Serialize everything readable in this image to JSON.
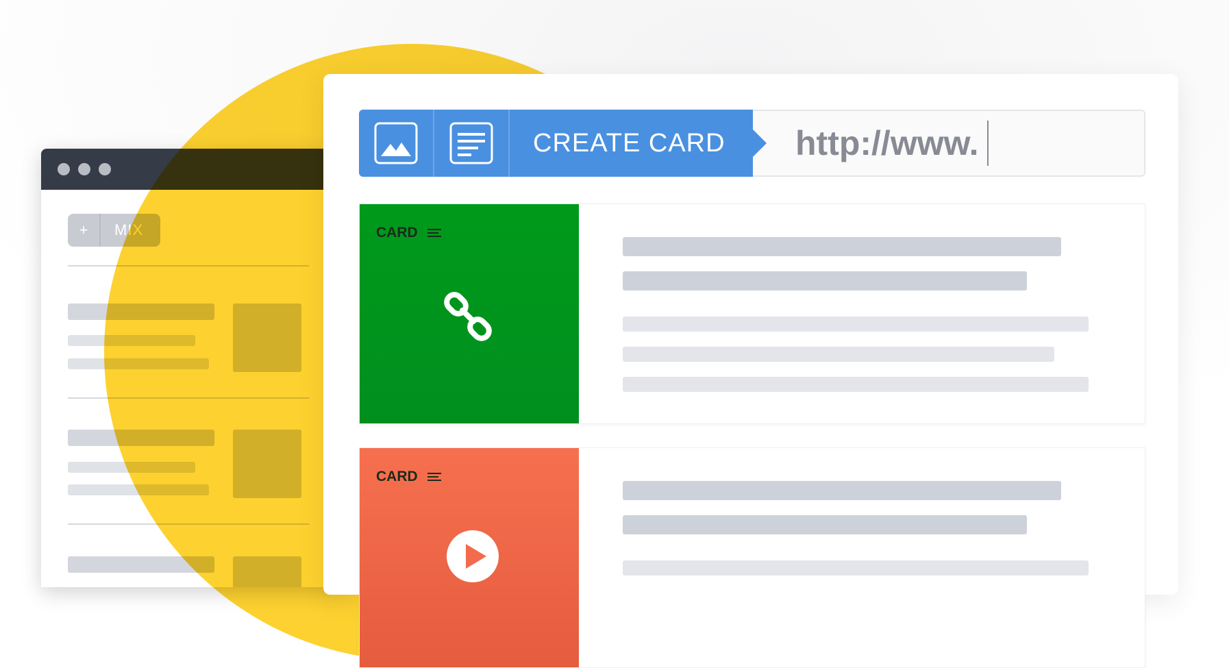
{
  "colors": {
    "background": "#ffffff",
    "accent_blue": "#4a90e0",
    "yellow": "#fdd12f",
    "card_green": "#009a1b",
    "card_orange": "#f36b4c",
    "browser_bar": "#363b48"
  },
  "back_window": {
    "plus_label": "+",
    "mix_label": "MIX"
  },
  "create_bar": {
    "image_icon": "image-icon",
    "text_icon": "text-lines-icon",
    "label": "CREATE CARD",
    "url_value": "http://www."
  },
  "cards": [
    {
      "tag": "CARD",
      "icon": "link-chain-icon",
      "color": "#009a1b"
    },
    {
      "tag": "CARD",
      "icon": "play-icon",
      "color": "#f36b4c"
    }
  ]
}
